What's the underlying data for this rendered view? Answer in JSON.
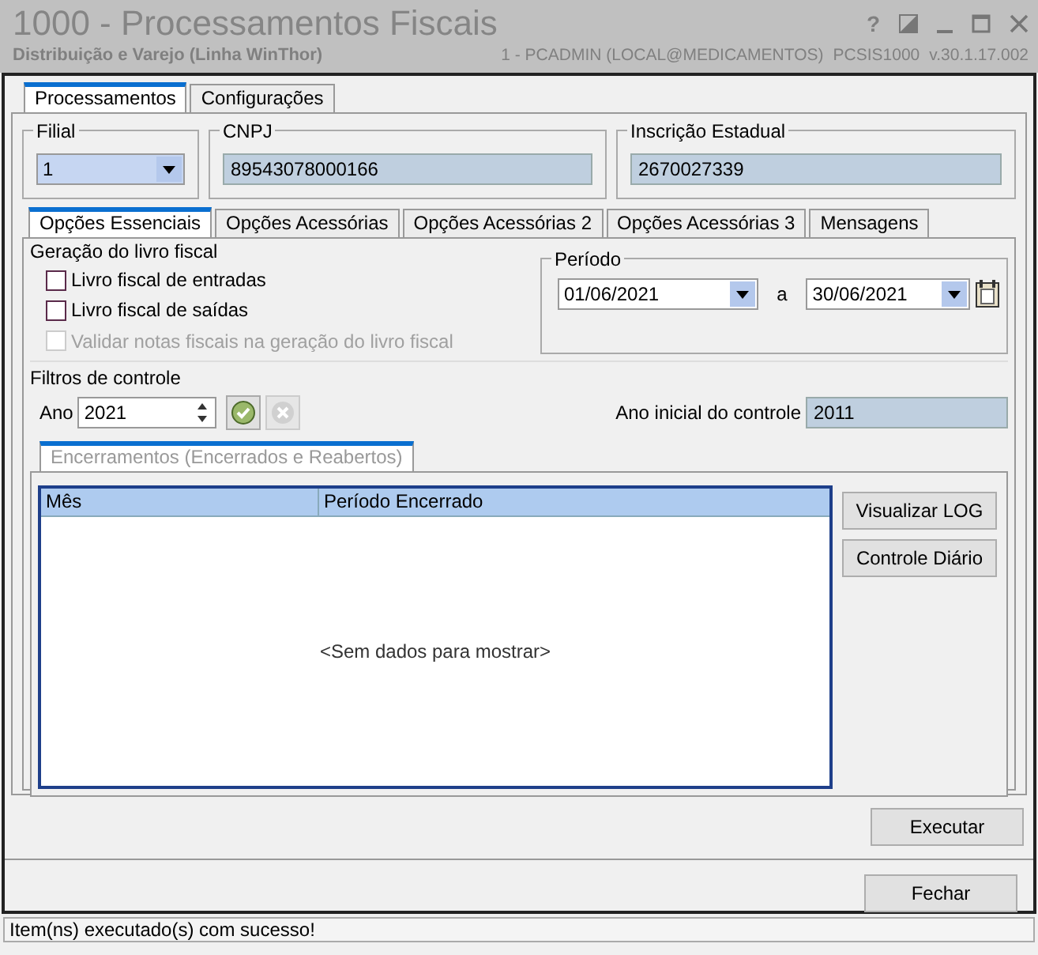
{
  "window": {
    "title": "1000 - Processamentos Fiscais",
    "subtitle": "Distribuição e Varejo (Linha WinThor)",
    "help_glyph": "?",
    "user": "1 - PCADMIN (LOCAL@MEDICAMENTOS)",
    "program": "PCSIS1000",
    "version": "v.30.1.17.002"
  },
  "main_tabs": [
    {
      "label": "Processamentos",
      "selected": true
    },
    {
      "label": "Configurações",
      "selected": false
    }
  ],
  "filial": {
    "label": "Filial",
    "value": "1"
  },
  "cnpj": {
    "label": "CNPJ",
    "value": "89543078000166"
  },
  "inscricao": {
    "label": "Inscrição Estadual",
    "value": "2670027339"
  },
  "sub_tabs": [
    {
      "label": "Opções Essenciais",
      "selected": true
    },
    {
      "label": "Opções Acessórias",
      "selected": false
    },
    {
      "label": "Opções Acessórias 2",
      "selected": false
    },
    {
      "label": "Opções Acessórias 3",
      "selected": false
    },
    {
      "label": "Mensagens",
      "selected": false
    }
  ],
  "livro": {
    "title": "Geração do livro fiscal",
    "checkboxes": [
      {
        "label": "Livro fiscal de entradas",
        "checked": false,
        "disabled": false
      },
      {
        "label": "Livro fiscal de saídas",
        "checked": false,
        "disabled": false
      },
      {
        "label": "Validar notas fiscais na geração do livro fiscal",
        "checked": false,
        "disabled": true
      }
    ]
  },
  "periodo": {
    "label": "Período",
    "from": "01/06/2021",
    "separator": "a",
    "to": "30/06/2021"
  },
  "filtros": {
    "title": "Filtros de controle",
    "ano_label": "Ano",
    "ano": "2021",
    "ano_inicial_label": "Ano inicial do controle",
    "ano_inicial": "2011"
  },
  "encerramentos": {
    "tab_label": "Encerramentos (Encerrados e Reabertos)",
    "disabled": true,
    "columns": [
      "Mês",
      "Período Encerrado"
    ],
    "empty_text": "<Sem dados para mostrar>"
  },
  "side_buttons": [
    "Visualizar LOG",
    "Controle Diário"
  ],
  "buttons": [
    "Executar",
    "Fechar"
  ],
  "status_bar": "Item(ns) executado(s) com sucesso!"
}
